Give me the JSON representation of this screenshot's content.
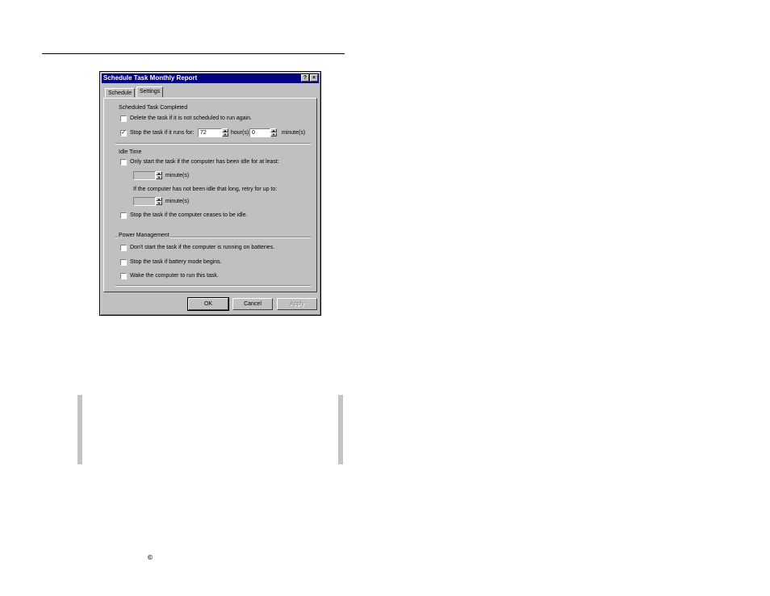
{
  "window": {
    "title": "Schedule Task Monthly Report",
    "help_glyph": "?",
    "close_glyph": "×"
  },
  "tabs": [
    {
      "label": "Schedule",
      "active": false
    },
    {
      "label": "Settings",
      "active": true
    }
  ],
  "completed": {
    "heading": "Scheduled Task Completed",
    "delete_label": "Delete the task if it is not scheduled to run again.",
    "delete_checked": false,
    "stop_label": "Stop the task if it runs for:",
    "stop_checked": true,
    "hours_value": "72",
    "hours_label": "hour(s)",
    "minutes_value": "0",
    "minutes_label": "minute(s)"
  },
  "idle": {
    "heading": "Idle Time",
    "only_start_label": "Only start the task if the computer has been idle for at least:",
    "only_start_checked": false,
    "minutes_label_1": "minute(s)",
    "retry_label": "If the computer has not been idle that long, retry for up to:",
    "minutes_label_2": "minute(s)",
    "stop_idle_label": "Stop the task if the computer ceases to be idle.",
    "stop_idle_checked": false
  },
  "power": {
    "heading": "Power Management",
    "batteries_label": "Don't start the task if the computer is running on batteries.",
    "batteries_checked": false,
    "battery_mode_label": "Stop the task if battery mode begins.",
    "battery_mode_checked": false,
    "wake_label": "Wake the computer to run this task.",
    "wake_checked": false
  },
  "buttons": {
    "ok": "OK",
    "cancel": "Cancel",
    "apply": "Apply"
  },
  "footer": {
    "copyright": "©"
  },
  "icons": {
    "checkmark": "✓",
    "spin_up": "▲",
    "spin_down": "▼"
  }
}
